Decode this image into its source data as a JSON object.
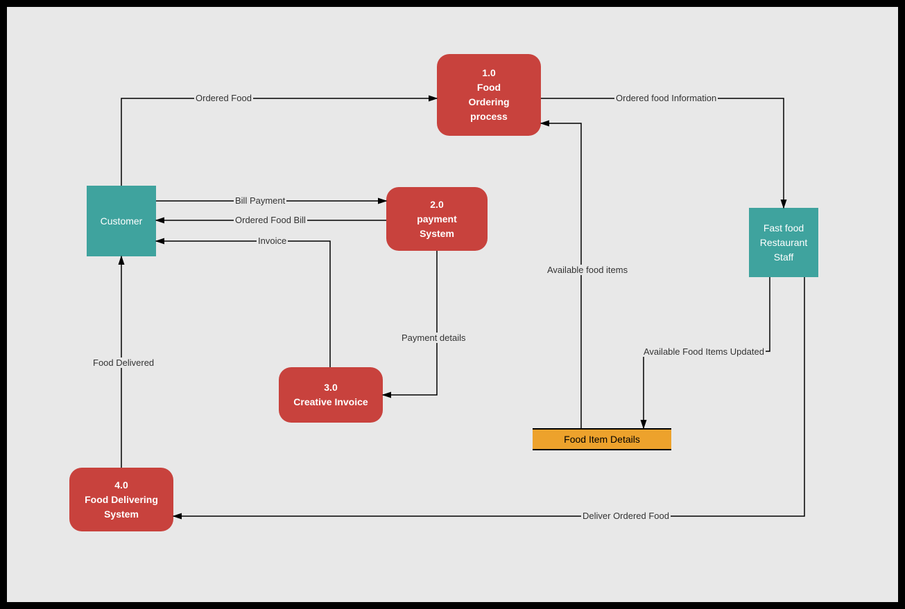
{
  "nodes": {
    "p1": {
      "num": "1.0",
      "l1": "Food",
      "l2": "Ordering",
      "l3": "process"
    },
    "p2": {
      "num": "2.0",
      "l1": "payment",
      "l2": "System"
    },
    "p3": {
      "num": "3.0",
      "l1": "Creative Invoice"
    },
    "p4": {
      "num": "4.0",
      "l1": "Food Delivering",
      "l2": "System"
    },
    "e1": "Customer",
    "e2_l1": "Fast food",
    "e2_l2": "Restaurant",
    "e2_l3": "Staff",
    "ds": "Food Item Details"
  },
  "labels": {
    "ordered_food": "Ordered Food",
    "ordered_food_info": "Ordered food Information",
    "bill_payment": "Bill Payment",
    "ordered_food_bill": "Ordered Food Bill",
    "invoice": "Invoice",
    "payment_details": "Payment details",
    "available_food": "Available food items",
    "available_updated": "Available Food Items Updated",
    "food_delivered": "Food Delivered",
    "deliver_ordered": "Deliver Ordered Food"
  }
}
